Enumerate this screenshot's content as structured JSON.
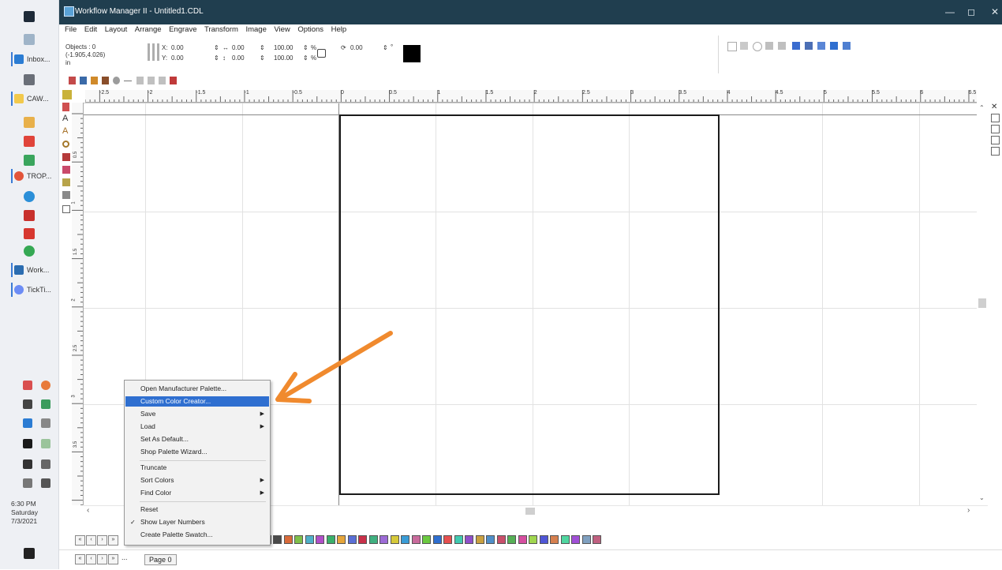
{
  "window": {
    "title": "Workflow Manager II - Untitled1.CDL"
  },
  "menubar": [
    "File",
    "Edit",
    "Layout",
    "Arrange",
    "Engrave",
    "Transform",
    "Image",
    "View",
    "Options",
    "Help"
  ],
  "taskbar": {
    "apps": [
      {
        "label": "Inbox...",
        "color": "#2b7cd3"
      },
      {
        "label": "CAW...",
        "color": "#f2c94c"
      },
      {
        "label": "TROP...",
        "color": "#e2543a"
      },
      {
        "label": "Work...",
        "color": "#2b6cb0"
      },
      {
        "label": "TickTi...",
        "color": "#6c8cf5"
      }
    ],
    "clock": {
      "time": "6:30 PM",
      "day": "Saturday",
      "date": "7/3/2021"
    }
  },
  "propbar": {
    "objects": "Objects : 0",
    "coords": "(-1.905,4.026)",
    "unit": "in",
    "x_label": "X:",
    "x_value": "0.00",
    "y_label": "Y:",
    "y_value": "0.00",
    "w_value": "0.00",
    "h_value": "0.00",
    "w_pct": "100.00",
    "h_pct": "100.00",
    "pct_symbol": "%",
    "rotate_value": "0.00",
    "deg": "°"
  },
  "ruler": {
    "h_ticks": [
      "-2.5",
      "-2",
      "-1.5",
      "-1",
      "-0.5",
      "0",
      "0.5",
      "1",
      "1.5",
      "2",
      "2.5",
      "3",
      "3.5",
      "4",
      "4.5",
      "5",
      "5.5",
      "6",
      "6.5"
    ],
    "v_ticks": [
      "0.5",
      "1",
      "1.5",
      "2",
      "2.5",
      "3",
      "3.5"
    ]
  },
  "context_menu": {
    "items": [
      {
        "label": "Open Manufacturer Palette...",
        "submenu": false,
        "checked": false,
        "highlighted": false
      },
      {
        "label": "Custom Color Creator...",
        "submenu": false,
        "checked": false,
        "highlighted": true
      },
      {
        "label": "Save",
        "submenu": true,
        "checked": false,
        "highlighted": false
      },
      {
        "label": "Load",
        "submenu": true,
        "checked": false,
        "highlighted": false
      },
      {
        "label": "Set As Default...",
        "submenu": false,
        "checked": false,
        "highlighted": false
      },
      {
        "label": "Shop Palette Wizard...",
        "submenu": false,
        "checked": false,
        "highlighted": false
      },
      {
        "label": "Truncate",
        "submenu": false,
        "checked": false,
        "highlighted": false
      },
      {
        "label": "Sort Colors",
        "submenu": true,
        "checked": false,
        "highlighted": false
      },
      {
        "label": "Find Color",
        "submenu": true,
        "checked": false,
        "highlighted": false
      },
      {
        "label": "Reset",
        "submenu": false,
        "checked": false,
        "highlighted": false
      },
      {
        "label": "Show Layer Numbers",
        "submenu": false,
        "checked": true,
        "highlighted": false
      },
      {
        "label": "Create Palette Swatch...",
        "submenu": false,
        "checked": false,
        "highlighted": false
      }
    ],
    "arrow_glyph": "▶",
    "check_glyph": "✓"
  },
  "pagebar": {
    "page_tab": "Page 0",
    "ellipsis": "..."
  },
  "nav": {
    "first": "«",
    "prev": "‹",
    "next": "›",
    "last": "»"
  },
  "annotation": {
    "arrow_color": "#f08a2e"
  },
  "colors": {
    "titlebar": "#203e4f",
    "highlight": "#2f6fd0"
  }
}
